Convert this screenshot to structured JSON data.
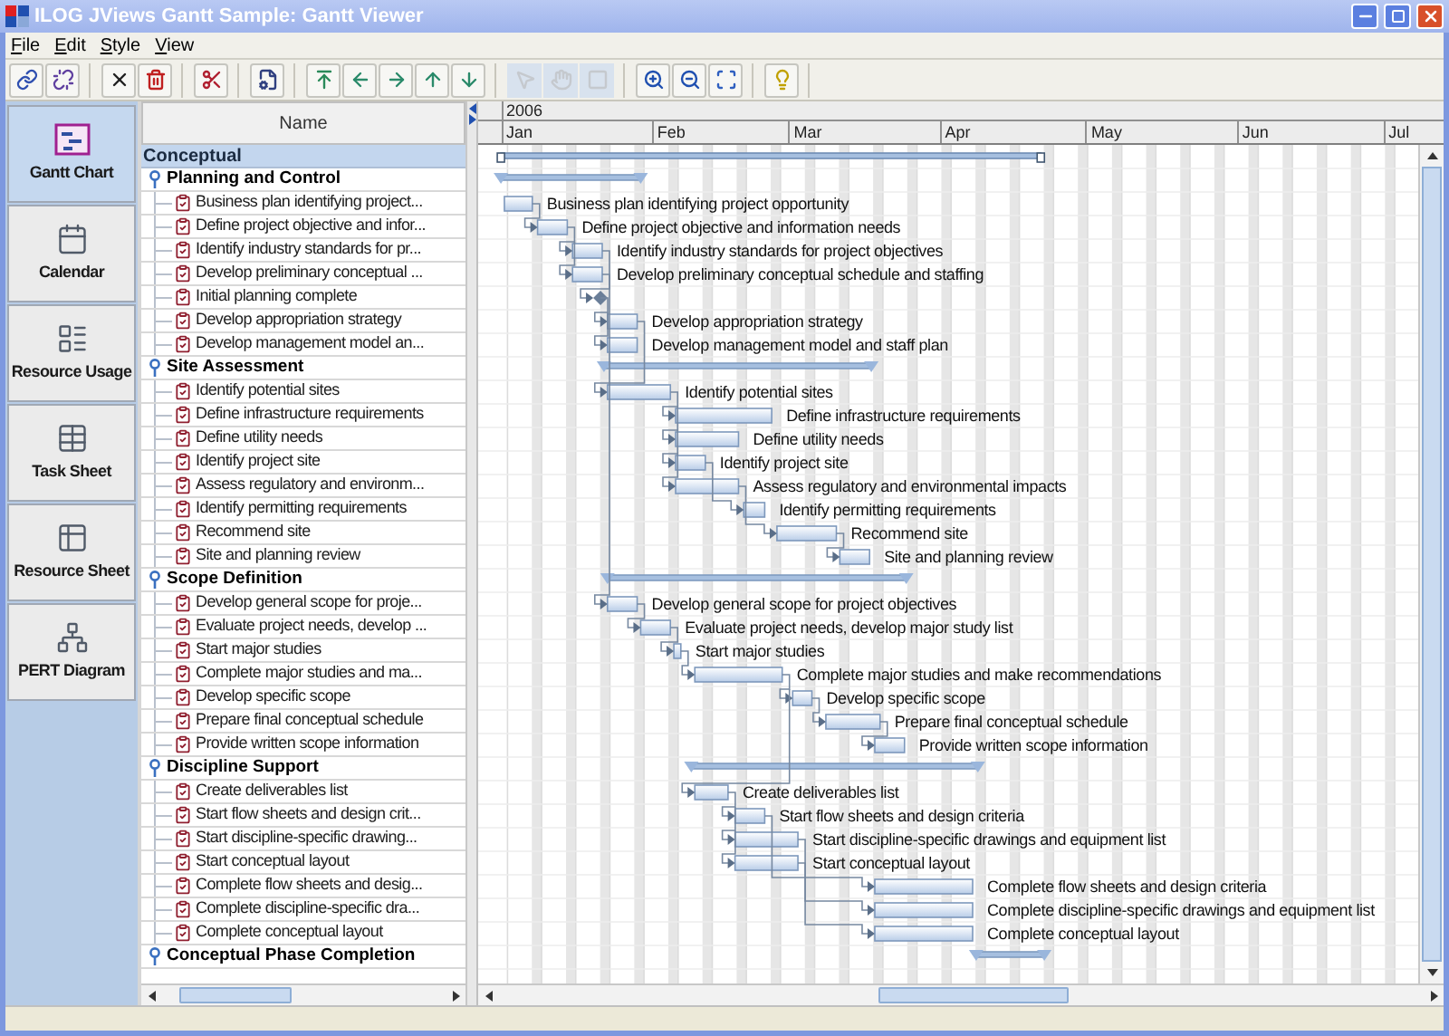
{
  "window": {
    "title": "ILOG JViews Gantt Sample: Gantt Viewer"
  },
  "menu": [
    "File",
    "Edit",
    "Style",
    "View"
  ],
  "toolbar": {
    "groups": [
      {
        "buttons": [
          {
            "disabled": false
          },
          {
            "disabled": false
          }
        ]
      },
      {
        "buttons": [
          {
            "disabled": false
          },
          {
            "disabled": false
          }
        ]
      },
      {
        "buttons": [
          {
            "disabled": false
          }
        ]
      },
      {
        "buttons": [
          {
            "disabled": false
          }
        ]
      },
      {
        "buttons": [
          {
            "disabled": false
          },
          {
            "disabled": false
          },
          {
            "disabled": false
          },
          {
            "disabled": false
          },
          {
            "disabled": false
          }
        ]
      },
      {
        "buttons": [
          {
            "disabled": true
          },
          {
            "disabled": true
          },
          {
            "disabled": true
          }
        ]
      },
      {
        "buttons": [
          {
            "disabled": false
          },
          {
            "disabled": false
          },
          {
            "disabled": false
          }
        ]
      },
      {
        "buttons": [
          {
            "disabled": false
          }
        ]
      }
    ]
  },
  "nav": {
    "items": [
      {
        "label": "Gantt Chart",
        "selected": true
      },
      {
        "label": "Calendar",
        "selected": false
      },
      {
        "label": "Resource Usage",
        "selected": false
      },
      {
        "label": "Task Sheet",
        "selected": false
      },
      {
        "label": "Resource Sheet",
        "selected": false
      },
      {
        "label": "PERT Diagram",
        "selected": false
      }
    ]
  },
  "tree": {
    "header": "Name",
    "root": {
      "kind": "project",
      "label": "Conceptual",
      "children": [
        {
          "kind": "summary",
          "label": "Planning and Control",
          "children": [
            {
              "kind": "task",
              "label": "Business plan identifying project...",
              "bar_label": "Business plan identifying project opportunity"
            },
            {
              "kind": "task",
              "label": "Define project objective and infor...",
              "bar_label": "Define project objective and information needs"
            },
            {
              "kind": "task",
              "label": "Identify industry standards for pr...",
              "bar_label": "Identify industry standards for project objectives"
            },
            {
              "kind": "task",
              "label": "Develop preliminary conceptual ...",
              "bar_label": "Develop preliminary conceptual schedule and staffing"
            },
            {
              "kind": "milestone",
              "label": "Initial planning complete"
            },
            {
              "kind": "task",
              "label": "Develop appropriation strategy",
              "bar_label": "Develop appropriation strategy"
            },
            {
              "kind": "task",
              "label": "Develop management model an...",
              "bar_label": "Develop management model and staff plan"
            }
          ]
        },
        {
          "kind": "summary",
          "label": "Site Assessment",
          "children": [
            {
              "kind": "task",
              "label": "Identify potential sites",
              "bar_label": "Identify potential sites"
            },
            {
              "kind": "task",
              "label": "Define infrastructure requirements",
              "bar_label": "Define infrastructure requirements"
            },
            {
              "kind": "task",
              "label": "Define utility needs",
              "bar_label": "Define utility needs"
            },
            {
              "kind": "task",
              "label": "Identify project site",
              "bar_label": "Identify project site"
            },
            {
              "kind": "task",
              "label": "Assess regulatory and environm...",
              "bar_label": "Assess regulatory and environmental impacts"
            },
            {
              "kind": "task",
              "label": "Identify permitting requirements",
              "bar_label": "Identify permitting requirements"
            },
            {
              "kind": "task",
              "label": "Recommend site",
              "bar_label": "Recommend site"
            },
            {
              "kind": "task",
              "label": "Site and planning review",
              "bar_label": "Site and planning review"
            }
          ]
        },
        {
          "kind": "summary",
          "label": "Scope Definition",
          "children": [
            {
              "kind": "task",
              "label": "Develop general scope for proje...",
              "bar_label": "Develop general scope for project objectives"
            },
            {
              "kind": "task",
              "label": "Evaluate project needs, develop ...",
              "bar_label": "Evaluate project needs, develop major study list"
            },
            {
              "kind": "task",
              "label": "Start major studies",
              "bar_label": "Start major studies"
            },
            {
              "kind": "task",
              "label": "Complete major studies and ma...",
              "bar_label": "Complete major studies and make recommendations"
            },
            {
              "kind": "task",
              "label": "Develop specific scope",
              "bar_label": "Develop specific scope"
            },
            {
              "kind": "task",
              "label": "Prepare final conceptual schedule",
              "bar_label": "Prepare final conceptual schedule"
            },
            {
              "kind": "task",
              "label": "Provide written scope information",
              "bar_label": "Provide written scope information"
            }
          ]
        },
        {
          "kind": "summary",
          "label": "Discipline Support",
          "children": [
            {
              "kind": "task",
              "label": "Create deliverables list",
              "bar_label": "Create deliverables list"
            },
            {
              "kind": "task",
              "label": "Start flow sheets and design crit...",
              "bar_label": "Start flow sheets and design criteria"
            },
            {
              "kind": "task",
              "label": "Start discipline-specific drawing...",
              "bar_label": "Start discipline-specific drawings and equipment list"
            },
            {
              "kind": "task",
              "label": "Start conceptual layout",
              "bar_label": "Start conceptual layout"
            },
            {
              "kind": "task",
              "label": "Complete flow sheets and desig...",
              "bar_label": "Complete flow sheets and design criteria"
            },
            {
              "kind": "task",
              "label": "Complete discipline-specific dra...",
              "bar_label": "Complete discipline-specific drawings and equipment list"
            },
            {
              "kind": "task",
              "label": "Complete conceptual layout",
              "bar_label": "Complete conceptual layout"
            }
          ]
        },
        {
          "kind": "summary",
          "label": "Conceptual Phase Completion"
        }
      ]
    }
  },
  "timeline": {
    "year": "2006",
    "months": [
      "Jan",
      "Feb",
      "Mar",
      "Apr",
      "May",
      "Jun",
      "Jul"
    ]
  }
}
